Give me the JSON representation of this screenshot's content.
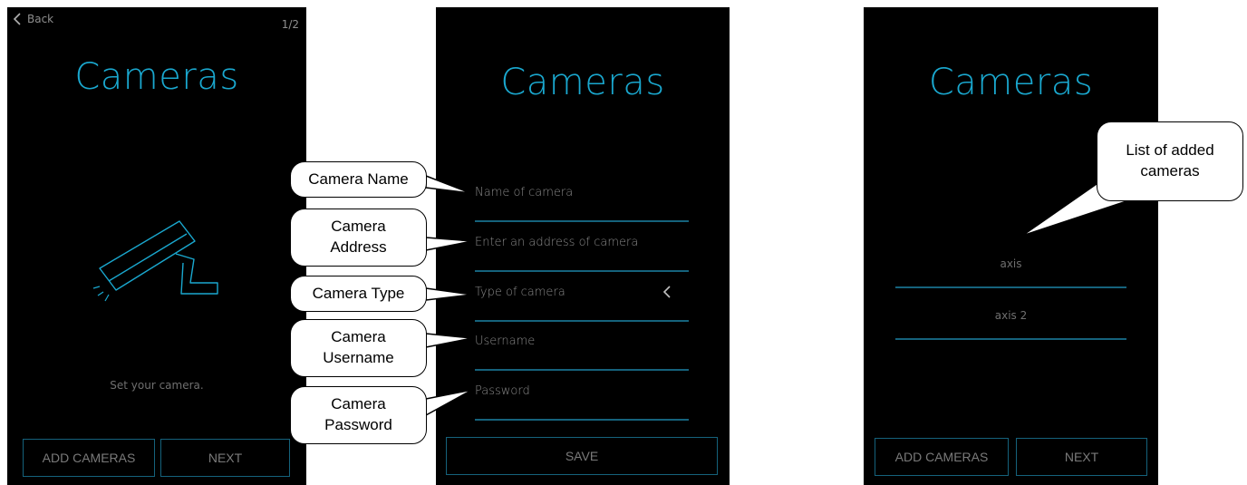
{
  "screen1": {
    "back_label": "Back",
    "page_indicator": "1/2",
    "title": "Cameras",
    "caption": "Set your camera.",
    "add_button": "ADD CAMERAS",
    "next_button": "NEXT",
    "icon": "security-camera-icon"
  },
  "screen2": {
    "title": "Cameras",
    "fields": [
      {
        "placeholder": "Name of camera"
      },
      {
        "placeholder": "Enter an address of camera"
      },
      {
        "placeholder": "Type of camera"
      },
      {
        "placeholder": "Username"
      },
      {
        "placeholder": "Password"
      }
    ],
    "save_button": "SAVE",
    "dropdown_icon": "chevron-left-icon"
  },
  "screen3": {
    "title": "Cameras",
    "cameras": [
      "axis",
      "axis 2"
    ],
    "add_button": "ADD CAMERAS",
    "next_button": "NEXT"
  },
  "annotations": {
    "name": "Camera Name",
    "address": "Camera Address",
    "type": "Camera Type",
    "username": "Camera Username",
    "password": "Camera Password",
    "list": "List of added cameras"
  },
  "colors": {
    "accent": "#1aa8cf",
    "line": "#15627c",
    "background": "#000000",
    "muted_text": "#8a8a8a"
  }
}
